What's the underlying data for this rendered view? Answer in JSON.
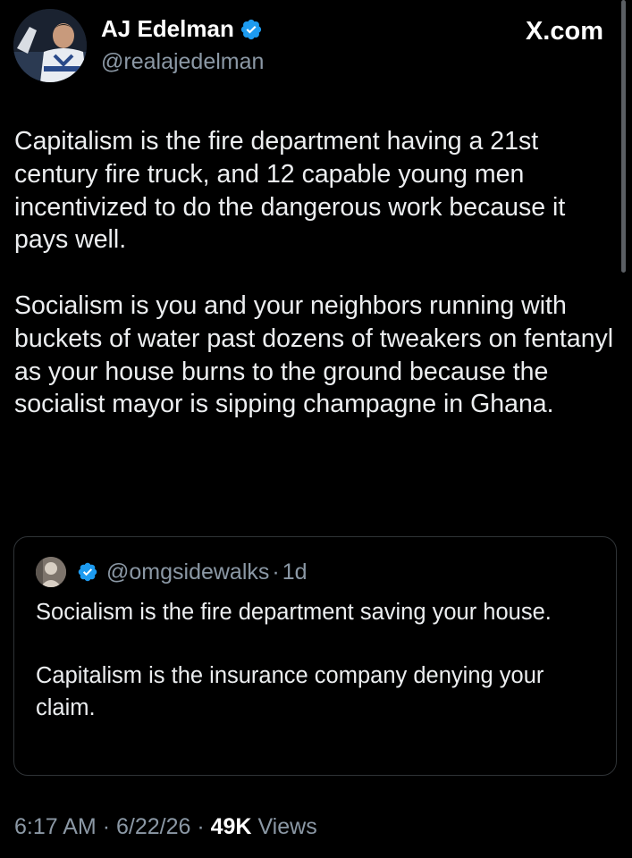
{
  "author": {
    "display_name": "AJ Edelman",
    "handle": "@realajedelman",
    "avatar_icon": "profile-photo",
    "verified_icon": "verified-badge-icon"
  },
  "site_label": "X.com",
  "post": {
    "paragraphs": [
      "Capitalism is the fire department having a 21st century fire truck, and 12 capable young men incentivized to do the dangerous work because it pays well.",
      "Socialism is you and your neighbors running with buckets of water past dozens of tweakers on fentanyl as your house burns to the ground because the socialist mayor is sipping champagne in Ghana."
    ]
  },
  "quoted_post": {
    "handle": "@omgsidewalks",
    "separator": "·",
    "time": "1d",
    "paragraphs": [
      "Socialism is the fire department saving your house.",
      "Capitalism is the insurance company denying your claim."
    ]
  },
  "meta": {
    "time": "6:17 AM",
    "date": "6/22/26",
    "views_count": "49K",
    "views_label": "Views",
    "separator": "·"
  },
  "colors": {
    "background": "#000000",
    "text": "#e7e9ea",
    "secondary_text": "#8b98a5",
    "verified_blue": "#1d9bf0",
    "card_border": "#2f3336"
  }
}
